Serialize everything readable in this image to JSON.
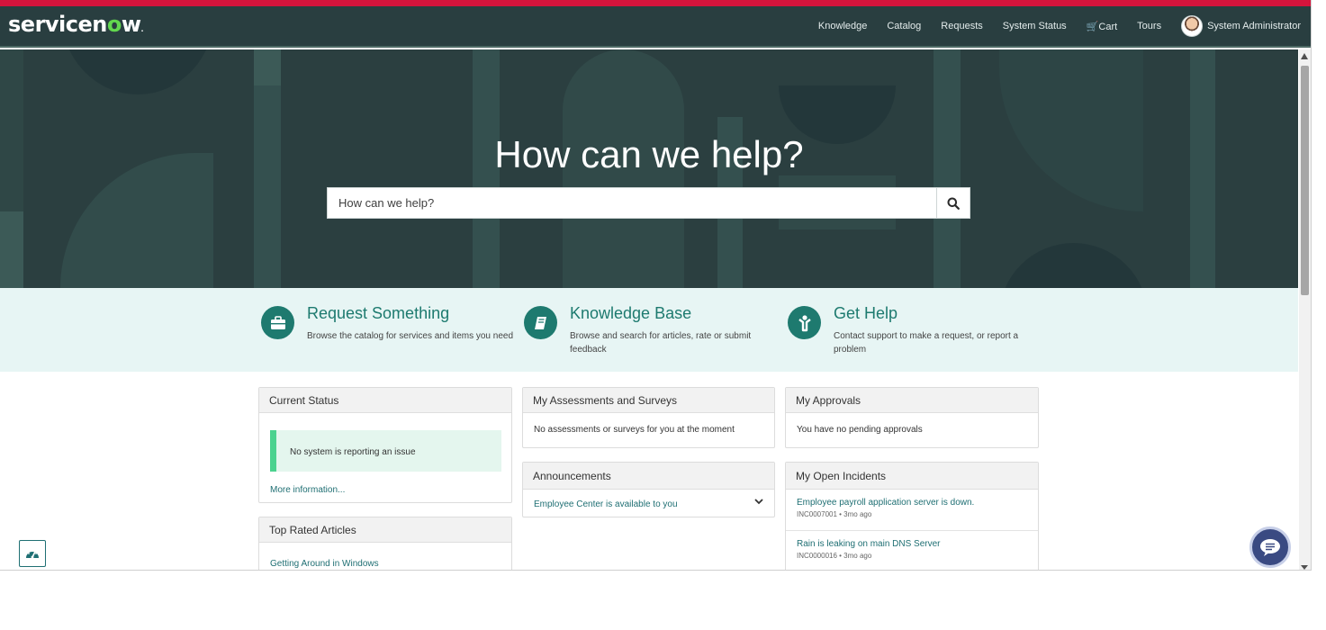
{
  "header": {
    "logo_text_pre": "servicen",
    "logo_text_o": "o",
    "logo_text_post": "w",
    "logo_tm": ".",
    "nav": [
      "Knowledge",
      "Catalog",
      "Requests",
      "System Status"
    ],
    "cart_label": "Cart",
    "tours_label": "Tours",
    "user_name": "System Administrator"
  },
  "hero": {
    "title": "How can we help?",
    "search_placeholder": "How can we help?"
  },
  "quick_links": [
    {
      "title": "Request Something",
      "desc": "Browse the catalog for services and items you need",
      "icon": "briefcase-icon"
    },
    {
      "title": "Knowledge Base",
      "desc": "Browse and search for articles, rate or submit feedback",
      "icon": "book-icon"
    },
    {
      "title": "Get Help",
      "desc": "Contact support to make a request, or report a problem",
      "icon": "person-help-icon"
    }
  ],
  "current_status": {
    "title": "Current Status",
    "message": "No system is reporting an issue",
    "more_link": "More information..."
  },
  "top_rated": {
    "title": "Top Rated Articles",
    "first_article": "Getting Around in Windows"
  },
  "assessments": {
    "title": "My Assessments and Surveys",
    "message": "No assessments or surveys for you at the moment"
  },
  "announcements": {
    "title": "Announcements",
    "item": "Employee Center is available to you"
  },
  "approvals": {
    "title": "My Approvals",
    "message": "You have no pending approvals"
  },
  "incidents": {
    "title": "My Open Incidents",
    "items": [
      {
        "title": "Employee payroll application server is down.",
        "meta": "INC0007001 • 3mo ago"
      },
      {
        "title": "Rain is leaking on main DNS Server",
        "meta": "INC0000016 • 3mo ago"
      }
    ]
  },
  "colors": {
    "brand_red": "#d4143c",
    "header_bg": "#293e40",
    "accent_teal": "#1e7a6f",
    "status_green": "#4bd28f"
  }
}
